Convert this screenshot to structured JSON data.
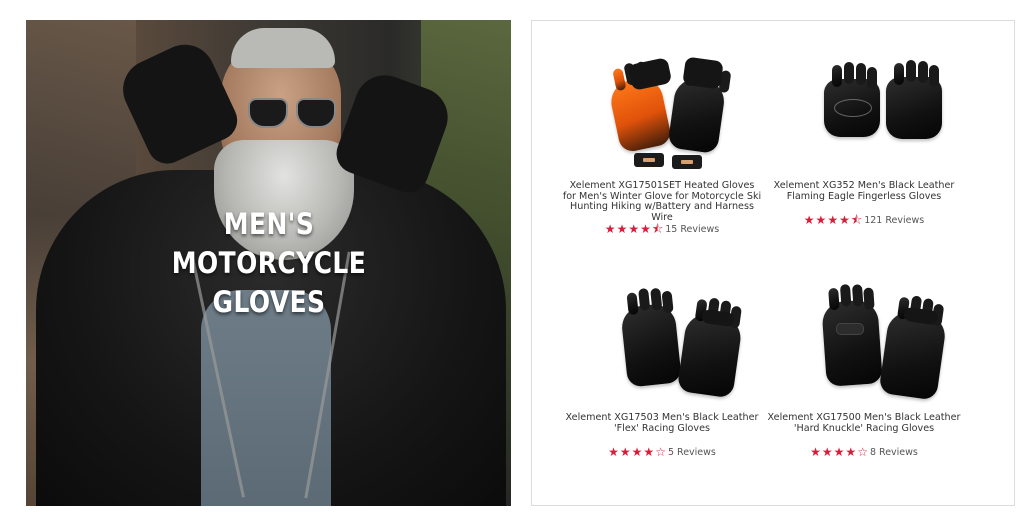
{
  "hero": {
    "title_lines": [
      "MEN'S",
      "MOTORCYCLE",
      "GLOVES"
    ]
  },
  "colors": {
    "star": "#d81e3a",
    "product_text": "#333333",
    "panel_border": "#dcdcdc"
  },
  "products": [
    {
      "name": "Xelement XG17501SET Heated Gloves for Men's Winter Glove for Motorcycle Ski Hunting Hiking w/Battery and Harness Wire",
      "rating": 4.5,
      "reviews": "15 Reviews",
      "image": "heated-gloves-image"
    },
    {
      "name": "Xelement XG352 Men's Black Leather Flaming Eagle Fingerless Gloves",
      "rating": 4.5,
      "reviews": "121 Reviews",
      "image": "fingerless-gloves-image"
    },
    {
      "name": "Xelement XG17503 Men's Black Leather 'Flex' Racing Gloves",
      "rating": 4,
      "reviews": "5 Reviews",
      "image": "flex-racing-gloves-image"
    },
    {
      "name": "Xelement XG17500 Men's Black Leather 'Hard Knuckle' Racing Gloves",
      "rating": 4,
      "reviews": "8 Reviews",
      "image": "hard-knuckle-gloves-image"
    }
  ]
}
